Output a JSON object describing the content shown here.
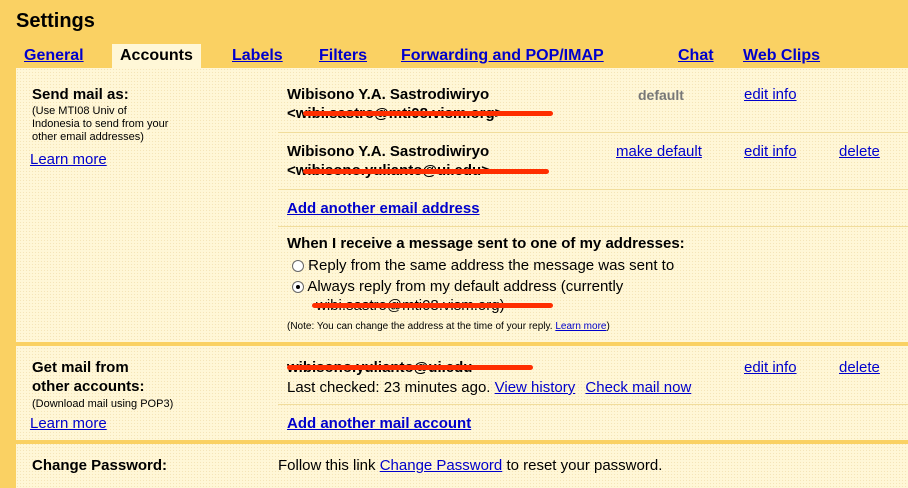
{
  "header": {
    "title": "Settings"
  },
  "tabs": [
    "General",
    "Accounts",
    "Labels",
    "Filters",
    "Forwarding and POP/IMAP",
    "Chat",
    "Web Clips"
  ],
  "send_mail": {
    "label": "Send mail as:",
    "help": [
      "(Use MTI08 Univ of",
      "Indonesia to send from your",
      "other email addresses)"
    ],
    "learn_more": "Learn more",
    "addresses": [
      {
        "name": "Wibisono Y.A. Sastrodiwiryo",
        "email": "<wibi.sastro@mti08.vism.org>",
        "status": "default",
        "edit": "edit info"
      },
      {
        "name": "Wibisono Y.A. Sastrodiwiryo",
        "email": "<wibisono.yulianto@ui.edu>",
        "make_default": "make default",
        "edit": "edit info",
        "delete": "delete"
      }
    ],
    "add_link": "Add another email address",
    "reply_heading": "When I receive a message sent to one of my addresses:",
    "reply_options": [
      "Reply from the same address the message was sent to",
      "Always reply from my default address (currently"
    ],
    "reply_current": "wibi.sastro@mti08.vism.org)",
    "reply_selected": 1,
    "note": "(Note: You can change the address at the time of your reply.",
    "note_link": "Learn more",
    "note_end": ")"
  },
  "get_mail": {
    "label_1": "Get mail from",
    "label_2": "other accounts:",
    "help": "(Download mail using POP3)",
    "learn_more": "Learn more",
    "account": "wibisono.yulianto@ui.edu",
    "edit": "edit info",
    "delete": "delete",
    "last_checked": "Last checked: 23 minutes ago.",
    "view_history": "View history",
    "check_now": "Check mail now",
    "add_link": "Add another mail account"
  },
  "password": {
    "label": "Change Password:",
    "text_before": "Follow this link",
    "link": "Change Password",
    "text_after": "to reset your password."
  },
  "colors": {
    "accent": "#fad163",
    "panel": "#fff7d7",
    "link": "#0000cc",
    "redaction": "#ff2e00"
  }
}
